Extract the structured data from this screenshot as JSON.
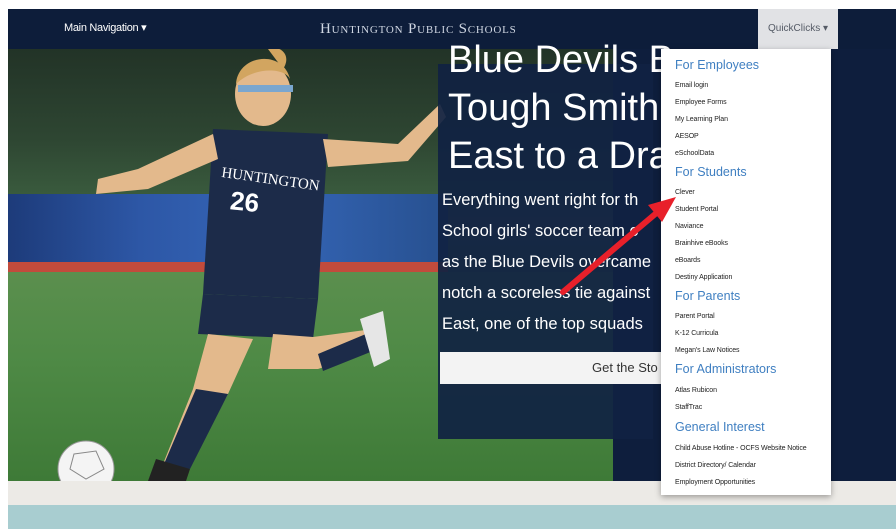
{
  "nav": {
    "main_label": "Main Navigation ▾",
    "site_title": "Huntington Public Schools",
    "quick_label": "QuickClicks ▾"
  },
  "hero": {
    "headline": [
      "Blue Devils B",
      "Tough Smith",
      "East to a Dra"
    ],
    "body": [
      "Everything went right for th",
      "School girls' soccer team o",
      "as the Blue Devils overcame",
      "notch a scoreless tie against",
      "East, one of the top squads"
    ],
    "button_label": "Get the Sto",
    "jersey_name": "HUNTINGTON",
    "jersey_number": "26"
  },
  "dropdown": {
    "sections": [
      {
        "title": "For Employees",
        "items": [
          "Email login",
          "Employee Forms",
          "My Learning Plan",
          "AESOP",
          "eSchoolData"
        ]
      },
      {
        "title": "For Students",
        "items": [
          "Clever",
          "Student Portal",
          "Naviance",
          "Brainhive eBooks",
          "eBoards",
          "Destiny Application"
        ]
      },
      {
        "title": "For Parents",
        "items": [
          "Parent Portal",
          "K-12 Curricula",
          "Megan's Law Notices"
        ]
      },
      {
        "title": "For Administrators",
        "items": [
          "Atlas Rubicon",
          "StaffTrac"
        ]
      },
      {
        "title": "General Interest",
        "items": [
          "Child Abuse Hotline - OCFS Website Notice",
          "District Directory/ Calendar",
          "Employment Opportunities"
        ]
      }
    ]
  },
  "colors": {
    "navbar": "#0d1d3a",
    "dropdown_heading": "#3f7fc1",
    "arrow": "#e8202a"
  }
}
